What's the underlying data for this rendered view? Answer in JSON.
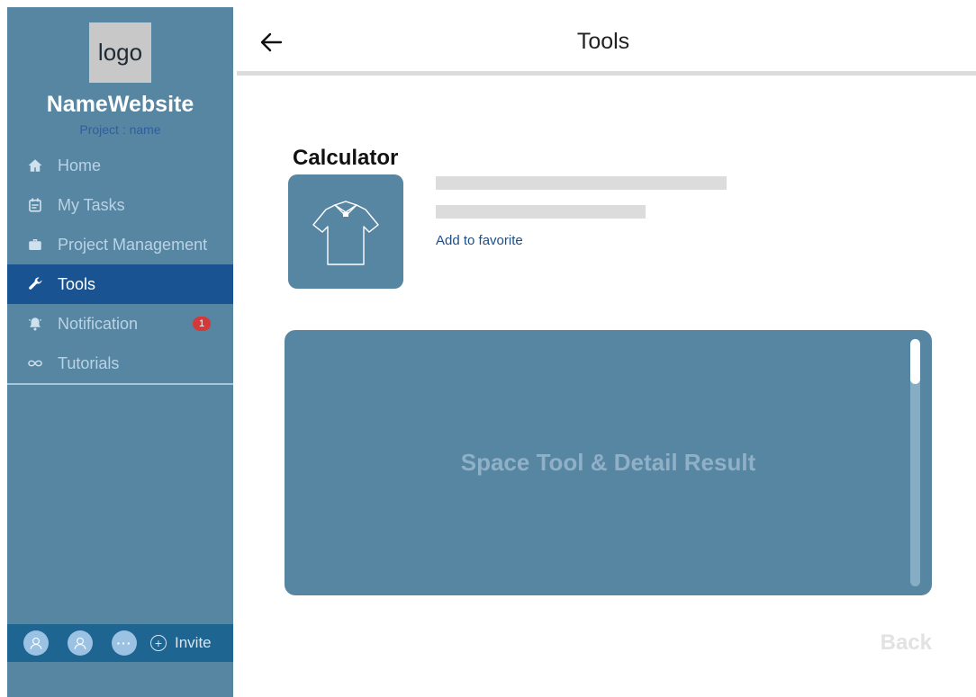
{
  "sidebar": {
    "logo_text": "logo",
    "site_name": "NameWebsite",
    "project_label": "Project : name",
    "items": [
      {
        "label": "Home",
        "icon": "home-icon"
      },
      {
        "label": "My Tasks",
        "icon": "calendar-icon"
      },
      {
        "label": "Project Management",
        "icon": "briefcase-icon"
      },
      {
        "label": "Tools",
        "icon": "wrench-icon",
        "active": true
      },
      {
        "label": "Notification",
        "icon": "bell-icon",
        "badge": "1"
      },
      {
        "label": "Tutorials",
        "icon": "infinity-icon"
      }
    ],
    "bottom": {
      "more_label": "···",
      "invite_label": "Invite"
    }
  },
  "header": {
    "title": "Tools"
  },
  "tool": {
    "title": "Calculator",
    "favorite_label": "Add to favorite",
    "image_icon": "shirt-icon"
  },
  "result": {
    "placeholder_text": "Space Tool & Detail Result"
  },
  "footer": {
    "back_label": "Back"
  },
  "colors": {
    "sidebar_bg": "#5786a2",
    "active_item": "#1a5391",
    "badge": "#d23a3a",
    "link": "#1e4e86"
  }
}
